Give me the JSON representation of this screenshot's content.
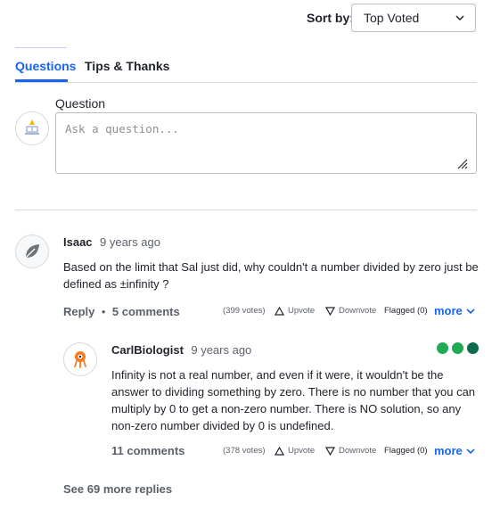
{
  "sort": {
    "label": "Sort by:",
    "selected": "Top Voted"
  },
  "tabs": [
    {
      "label": "Questions"
    },
    {
      "label": "Tips & Thanks"
    }
  ],
  "question_form": {
    "label": "Question",
    "placeholder": "Ask a question..."
  },
  "question": {
    "author": "Isaac",
    "time": "9 years ago",
    "text": "Based on the limit that Sal just did, why couldn't a number divided by zero just be defined as ±infinity ?",
    "reply_label": "Reply",
    "separator": "•",
    "comments": "5 comments",
    "votes": "(399 votes)",
    "upvote": "Upvote",
    "downvote": "Downvote",
    "flagged": "Flagged (0)",
    "more": "more"
  },
  "answer": {
    "author": "CarlBiologist",
    "time": "9 years ago",
    "text": "Infinity is not a real number, and even if it were, it wouldn't be the answer to dividing something by zero. There is no number that you can multiply by 0 to get a non-zero number. There is NO solution, so any non-zero number divided by 0 is undefined.",
    "comments": "11 comments",
    "votes": "(378 votes)",
    "upvote": "Upvote",
    "downvote": "Downvote",
    "flagged": "Flagged (0)",
    "more": "more"
  },
  "see_more": "See 69 more replies",
  "colors": {
    "accent": "#1865f2",
    "badge_green": "#1fab54",
    "badge_dark": "#0b6b4a",
    "text": "#21242c",
    "muted": "#5b616a"
  }
}
